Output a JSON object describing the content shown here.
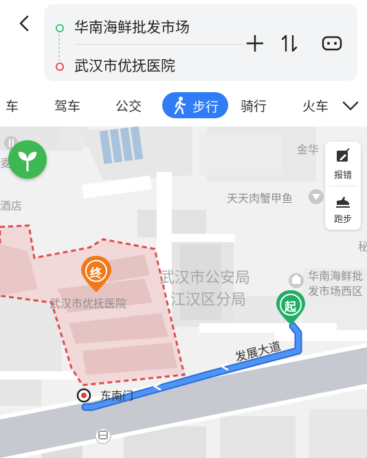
{
  "route": {
    "from": "华南海鲜批发市场",
    "to": "武汉市优抚医院"
  },
  "tabs": [
    {
      "label": "车"
    },
    {
      "label": "驾车"
    },
    {
      "label": "公交"
    },
    {
      "label": "步行",
      "active": true
    },
    {
      "label": "骑行"
    },
    {
      "label": "火车"
    }
  ],
  "tools": {
    "report_label": "报错",
    "run_label": "跑步"
  },
  "map": {
    "labels": {
      "jinhua": "金华",
      "shop1": "天天肉蟹甲鱼",
      "market_poi": "华南海鲜批",
      "market_poi2": "发市场西区",
      "police1": "武汉市公安局",
      "police2": "江汉区分局",
      "hospital": "武汉市优抚医院",
      "road": "发展大道",
      "gate": "东南门",
      "start_marker": "起",
      "end_marker": "终",
      "left_edge1": "酒店",
      "left_edge2": "麦",
      "right_edge": "秘"
    },
    "colors": {
      "route": "#3b86f0",
      "start": "#1fae63",
      "end": "#f07a1a",
      "accent": "#2f7cf6"
    }
  },
  "icons": {
    "back": "chevron-left-icon",
    "add": "plus-icon",
    "swap": "swap-icon",
    "car": "car-icon",
    "walk": "walk-icon",
    "more": "chevron-down-icon",
    "report": "edit-icon",
    "run": "shoe-icon",
    "eco": "sprout-icon",
    "bus": "bus-stop-icon"
  }
}
